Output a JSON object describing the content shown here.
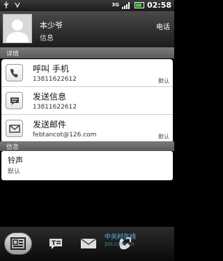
{
  "status_bar": {
    "network": "3G",
    "time": "02:58",
    "icons": [
      "usb-icon",
      "signal-icon",
      "data-icon",
      "battery-icon"
    ]
  },
  "header": {
    "name": "本少爷",
    "subtitle": "信息",
    "action": "电话"
  },
  "sections": {
    "details": "详情",
    "info": "信息"
  },
  "rows": [
    {
      "icon": "phone-icon",
      "title": "呼叫 手机",
      "sub": "13811622612",
      "tag": "默认"
    },
    {
      "icon": "message-icon",
      "title": "发送信息",
      "sub": "13811622612",
      "tag": ""
    },
    {
      "icon": "mail-icon",
      "title": "发送邮件",
      "sub": "febtancot@126.com",
      "tag": "默认"
    }
  ],
  "ringtone": {
    "title": "铃声",
    "sub": "默认"
  },
  "toolbar": {
    "buttons": [
      "contact-card-icon",
      "text-message-icon",
      "email-icon",
      "phone-update-icon"
    ]
  },
  "watermark": {
    "line1": "中关村在线",
    "line2": "zol.com.cn"
  },
  "colors": {
    "header_bg": "#2a2a2a",
    "section_bg": "#666666",
    "card_bg": "#ffffff",
    "battery": "#35d135"
  }
}
